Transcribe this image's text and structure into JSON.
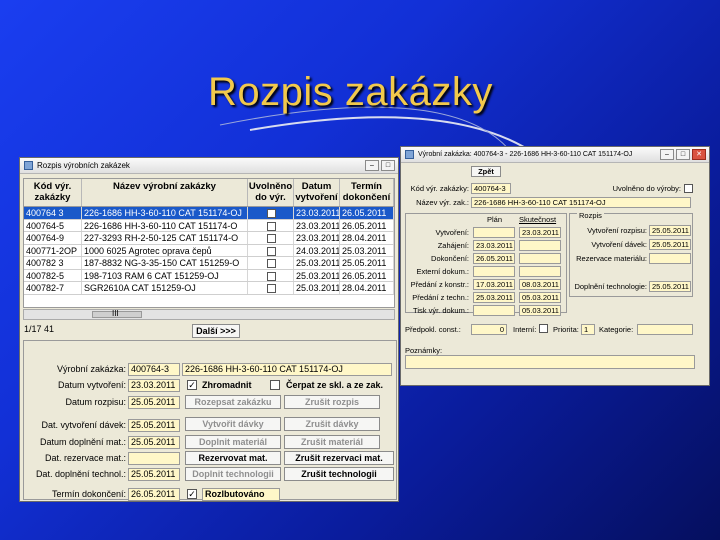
{
  "slide_title": "Rozpis zakázky",
  "list_window": {
    "title": "Rozpis výrobních zakázek",
    "columns": [
      "Kód výr. zakázky",
      "Název výrobní zakázky",
      "Uvolněno do výr.",
      "Datum vytvoření",
      "Termín dokončení"
    ],
    "rows": [
      {
        "code": "400764 3",
        "name": "226-1686 HH-3-60-110  CAT 151174-OJ",
        "date": "23.03.2011",
        "term": "26.05.2011",
        "selected": true
      },
      {
        "code": "400764-5",
        "name": "226-1686 HH-3-60-110  CAT 151174-O",
        "date": "23.03.2011",
        "term": "26.05.2011",
        "selected": false
      },
      {
        "code": "400764-9",
        "name": "227-3293  RH-2-50-125  CAT 151174-O",
        "date": "23.03.2011",
        "term": "28.04.2011",
        "selected": false
      },
      {
        "code": "400771-2OP",
        "name": "1000 6025 Agrotec oprava čepů",
        "date": "24.03.2011",
        "term": "25.03.2011",
        "selected": false
      },
      {
        "code": "400782 3",
        "name": "187-8832 NG-3-35-150  CAT 151259-O",
        "date": "25.03.2011",
        "term": "25.05.2011",
        "selected": false
      },
      {
        "code": "400782-5",
        "name": "198-7103  RAM 6   CAT 151259-OJ",
        "date": "25.03.2011",
        "term": "26.05.2011",
        "selected": false
      },
      {
        "code": "400782-7",
        "name": "SGR2610A  CAT 151259-OJ",
        "date": "25.03.2011",
        "term": "28.04.2011",
        "selected": false
      }
    ],
    "scroll_mid": "III",
    "record_count": "1/17  41",
    "next_button": "Další >>>",
    "form": {
      "order_label": "Výrobní zakázka:",
      "order_code": "400764-3",
      "order_name": "226-1686 HH-3-60-110  CAT 151174-OJ",
      "created_label": "Datum vytvoření:",
      "created_value": "23.03.2011",
      "rozpis_label": "Datum rozpisu:",
      "rozpis_value": "25.05.2011",
      "davek_label": "Dat. vytvoření dávek:",
      "davek_value": "25.05.2011",
      "dopl_mat_label": "Datum doplnění mat.:",
      "dopl_mat_value": "25.05.2011",
      "rez_mat_label": "Dat. rezervace mat.:",
      "rez_mat_value": "",
      "dopl_tech_label": "Dat. doplnění technol.:",
      "dopl_tech_value": "25.05.2011",
      "term_label": "Termín dokončení:",
      "term_value": "26.05.2011",
      "zhromadnit": "Zhromadnit",
      "cerpat": "Čerpat ze skl. a ze zak.",
      "rozpis_btn": "Rozepsat zakázku",
      "zrusit_rozpis": "Zrušit rozpis",
      "vytvorit_davky": "Vytvořit dávky",
      "zrusit_davky": "Zrušit dávky",
      "doplnit_material": "Doplnit materiál",
      "zrusit_material": "Zrušit materiál",
      "rezervovat": "Rezervovat mat.",
      "zrusit_rezervaci": "Zrušit rezervaci mat.",
      "doplnit_technologii": "Doplnit technologii",
      "zrusit_technologii": "Zrušit technologii",
      "rozlbutovano": "Rozlbutováno"
    }
  },
  "detail_window": {
    "title": "Výrobní zakázka: 400764-3 - 226-1686 HH-3-60-110 CAT 151174-OJ",
    "zpet": "Zpět",
    "kod_label": "Kód výr. zakázky:",
    "kod_value": "400764-3",
    "nazev_label": "Název výr. zak.:",
    "nazev_value": "226-1686 HH-3-60-110  CAT 151174-OJ",
    "uvolneno_label": "Uvolněno do výroby:",
    "plan_header": "Plán",
    "skut_header": "Skutečnost",
    "rozpis_header": "Rozpis",
    "left_rows": [
      {
        "label": "Vytvoření:",
        "plan": "",
        "skut": "23.03.2011"
      },
      {
        "label": "Zahájení:",
        "plan": "23.03.2011",
        "skut": ""
      },
      {
        "label": "Dokončení:",
        "plan": "26.05.2011",
        "skut": ""
      },
      {
        "label": "Externí dokum.:",
        "plan": "",
        "skut": ""
      },
      {
        "label": "Předání z konstr.:",
        "plan": "17.03.2011",
        "skut": "08.03.2011"
      },
      {
        "label": "Předání z techn.:",
        "plan": "25.03.2011",
        "skut": "05.03.2011"
      }
    ],
    "right_rows": [
      {
        "label": "Vytvoření rozpisu:",
        "value": "25.05.2011"
      },
      {
        "label": "Vytvoření dávek:",
        "value": "25.05.2011"
      },
      {
        "label": "Rezervace materiálu:",
        "value": ""
      },
      {
        "label": "Doplnění technologie:",
        "value": "25.05.2011"
      }
    ],
    "tisk_label": "Tisk výr. dokum.:",
    "tisk_value": "05.03.2011",
    "pocet_label": "Předpokl. const.:",
    "pocet_value": "0",
    "interni_label": "Interní:",
    "priorita_label": "Priorita:",
    "priorita_value": "1",
    "kategorie_label": "Kategorie:",
    "poznamky_label": "Poznámky:"
  }
}
